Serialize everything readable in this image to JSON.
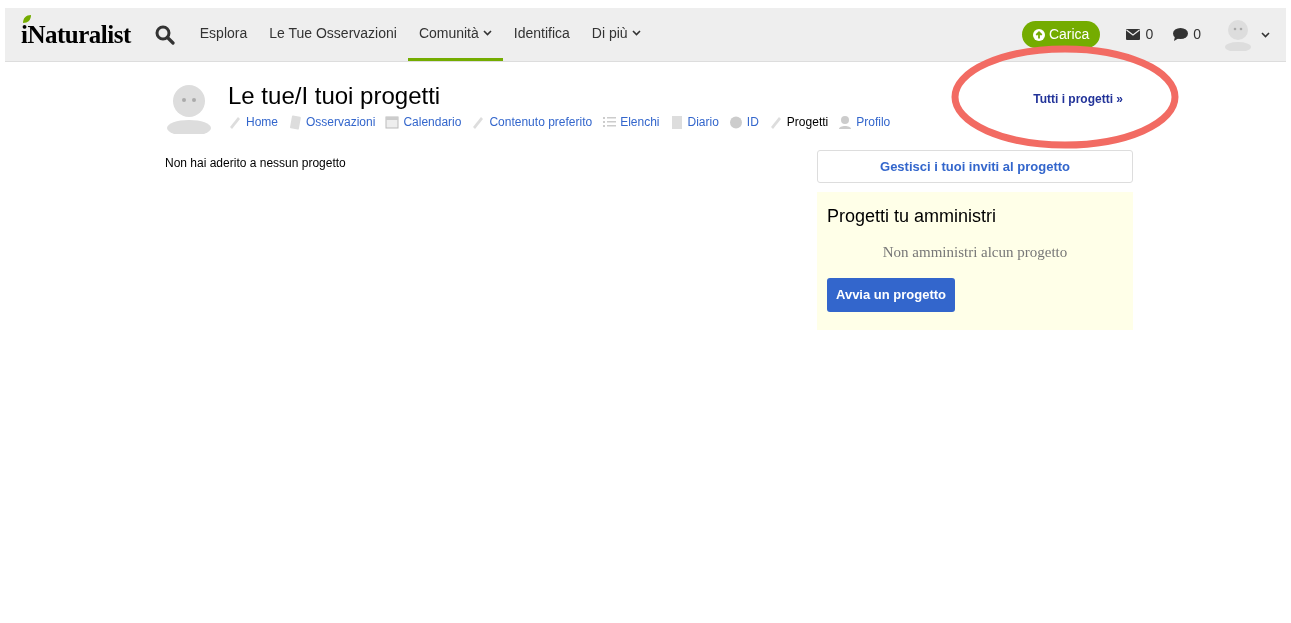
{
  "header": {
    "logo": "iNaturalist",
    "nav": [
      {
        "label": "Esplora",
        "selected": false,
        "dropdown": false
      },
      {
        "label": "Le Tue Osservazioni",
        "selected": false,
        "dropdown": false
      },
      {
        "label": "Comunità",
        "selected": true,
        "dropdown": true
      },
      {
        "label": "Identifica",
        "selected": false,
        "dropdown": false
      },
      {
        "label": "Di più",
        "selected": false,
        "dropdown": true
      }
    ],
    "upload_button": "Carica",
    "messages_count": "0",
    "notifications_count": "0"
  },
  "page": {
    "title": "Le tue/I tuoi progetti",
    "tabs": [
      {
        "label": "Home",
        "selected": false
      },
      {
        "label": "Osservazioni",
        "selected": false
      },
      {
        "label": "Calendario",
        "selected": false
      },
      {
        "label": "Contenuto preferito",
        "selected": false
      },
      {
        "label": "Elenchi",
        "selected": false
      },
      {
        "label": "Diario",
        "selected": false
      },
      {
        "label": "ID",
        "selected": false
      },
      {
        "label": "Progetti",
        "selected": true
      },
      {
        "label": "Profilo",
        "selected": false
      }
    ],
    "all_projects_link": "Tutti i progetti »",
    "empty_message": "Non hai aderito a nessun progetto",
    "manage_invites_button": "Gestisci i tuoi inviti al progetto",
    "admin_panel": {
      "title": "Progetti tu amministri",
      "empty_message": "Non amministri alcun progetto",
      "start_button": "Avvia un progetto"
    }
  }
}
